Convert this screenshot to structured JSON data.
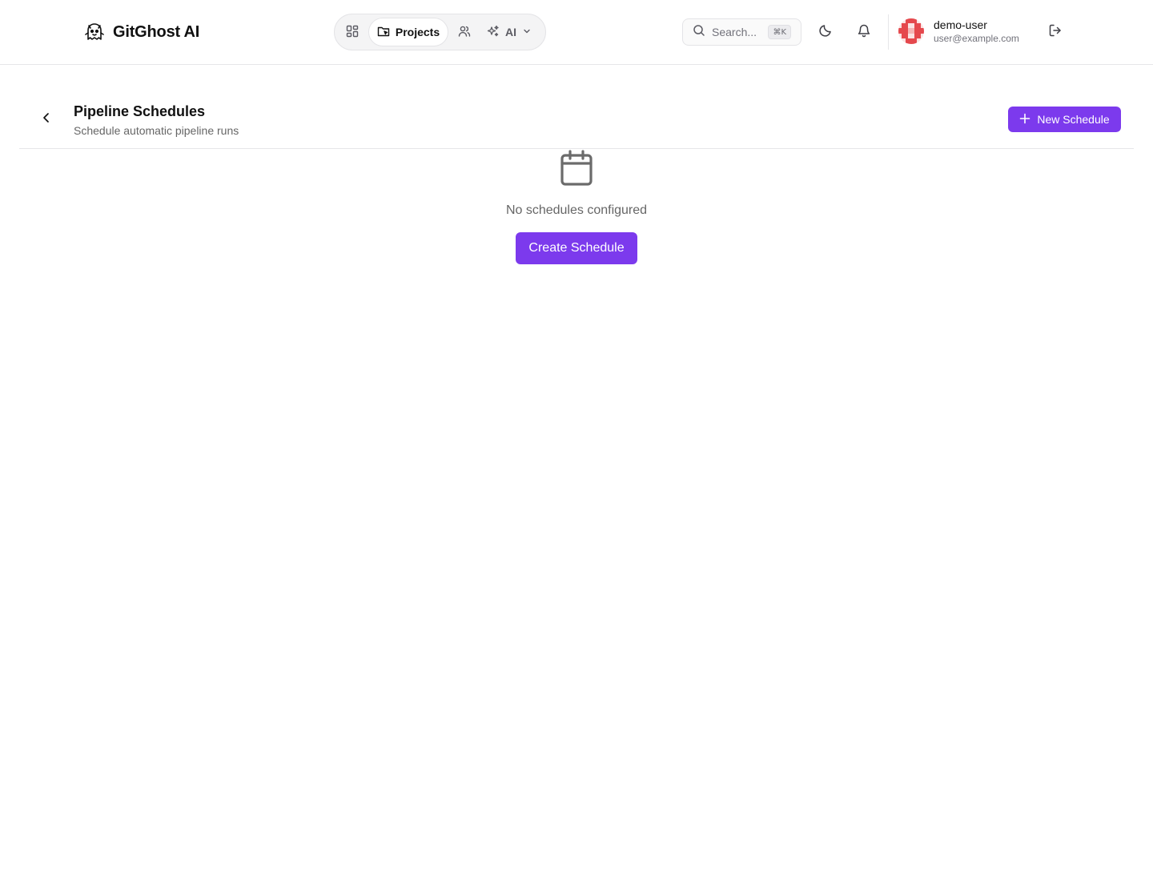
{
  "app": {
    "name": "GitGhost AI"
  },
  "nav": {
    "items": [
      {
        "label": "",
        "icon": "dashboard-icon"
      },
      {
        "label": "Projects",
        "icon": "folder-icon",
        "active": true
      },
      {
        "label": "",
        "icon": "users-icon"
      },
      {
        "label": "AI",
        "icon": "sparkles-icon",
        "dropdown": true
      }
    ]
  },
  "search": {
    "placeholder": "Search...",
    "shortcut": "⌘K"
  },
  "user": {
    "name": "demo-user",
    "email": "user@example.com"
  },
  "page": {
    "title": "Pipeline Schedules",
    "subtitle": "Schedule automatic pipeline runs",
    "new_button": "New Schedule"
  },
  "empty_state": {
    "message": "No schedules configured",
    "button": "Create Schedule"
  },
  "colors": {
    "accent": "#7c3aed",
    "avatar": "#e5484d"
  }
}
